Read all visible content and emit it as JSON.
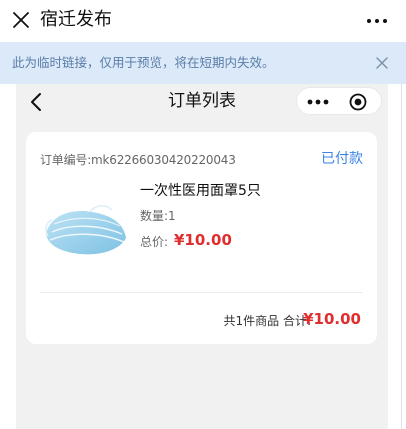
{
  "topbar": {
    "title": "宿迁发布",
    "close_icon": "close-icon",
    "more_icon": "more-dots-icon"
  },
  "notice": {
    "text": "此为临时链接，仅用于预览，将在短期内失效。",
    "close_icon": "close-icon"
  },
  "app_nav": {
    "title": "订单列表",
    "back_icon": "chevron-left-icon",
    "capsule_more_icon": "more-dots-icon",
    "capsule_close_icon": "target-circle-icon"
  },
  "order": {
    "order_number_label": "订单编号:mk62266030420220043",
    "status": "已付款",
    "product_name": "一次性医用面罩5只",
    "quantity_label": "数量:1",
    "price_label": "总价:",
    "price": "¥10.00",
    "summary_label": "共1件商品 合计:",
    "total": "¥10.00"
  },
  "colors": {
    "accent_blue": "#3b82e6",
    "price_red": "#e02d2d",
    "notice_bg": "#dbe9f8",
    "notice_text": "#5a7da8",
    "page_bg": "#f1f1f1"
  }
}
